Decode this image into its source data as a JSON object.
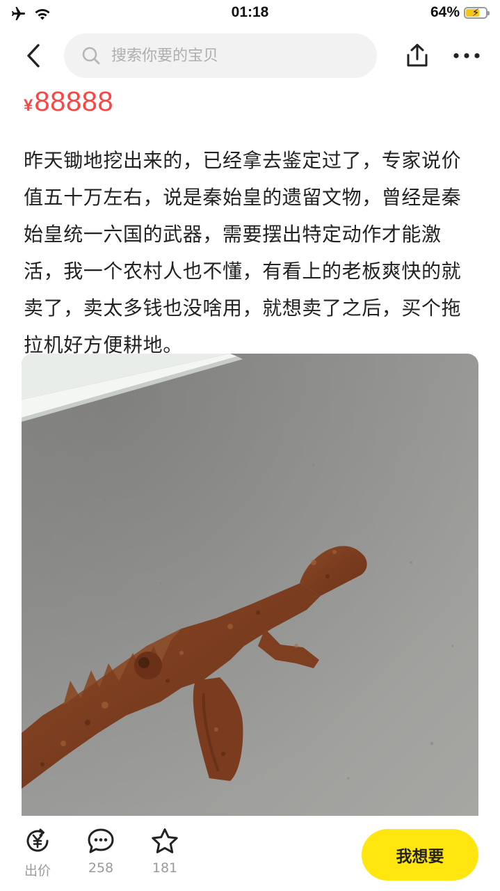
{
  "status_bar": {
    "time": "01:18",
    "battery_percent_label": "64%",
    "battery_level": 0.64,
    "icons": [
      "airplane-icon",
      "wifi-icon",
      "battery-charging-icon"
    ]
  },
  "nav": {
    "search_placeholder": "搜索你要的宝贝",
    "icons": [
      "back-icon",
      "search-icon",
      "share-icon",
      "more-icon"
    ]
  },
  "listing": {
    "price_symbol": "¥",
    "price_value": "88888",
    "description": "昨天锄地挖出来的，已经拿去鉴定过了，专家说价值五十万左右，说是秦始皇的遗留文物，曾经是秦始皇统一六国的武器，需要摆出特定动作才能激活，我一个农村人也不懂，有看上的老板爽快的就卖了，卖太多钱也没啥用，就想卖了之后，买个拖拉机好方便耕地。"
  },
  "bottom_bar": {
    "offer_label": "出价",
    "comments_count": "258",
    "favorites_count": "181",
    "want_button_label": "我想要",
    "icons": [
      "yen-refresh-icon",
      "comment-icon",
      "star-icon"
    ]
  },
  "colors": {
    "price": "#ff4444",
    "want_button": "#ffe60f",
    "muted_text": "#9a9a9a",
    "search_bg": "#f2f2f2"
  }
}
